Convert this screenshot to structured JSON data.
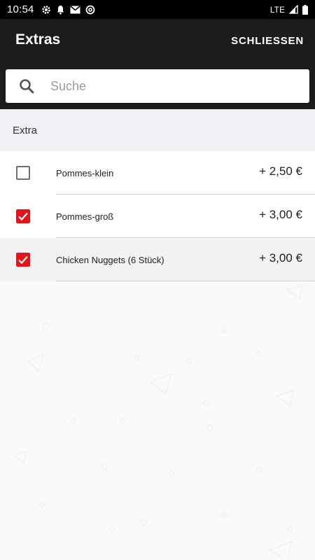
{
  "status_bar": {
    "time": "10:54",
    "network": "LTE",
    "icons": [
      "settings-icon",
      "notification-bell-icon",
      "gmail-icon",
      "at-sign-icon"
    ]
  },
  "app_bar": {
    "title": "Extras",
    "close_label": "SCHLIESSEN"
  },
  "search": {
    "placeholder": "Suche",
    "value": ""
  },
  "section": {
    "title": "Extra"
  },
  "items": [
    {
      "label": "Pommes-klein",
      "price": "+ 2,50 €",
      "checked": false
    },
    {
      "label": "Pommes-groß",
      "price": "+ 3,00 €",
      "checked": true
    },
    {
      "label": "Chicken Nuggets (6 Stück)",
      "price": "+ 3,00 €",
      "checked": true
    }
  ],
  "colors": {
    "accent": "#e8131a",
    "appbar": "#1c1c1c",
    "section_bg": "#f0f1f5"
  }
}
